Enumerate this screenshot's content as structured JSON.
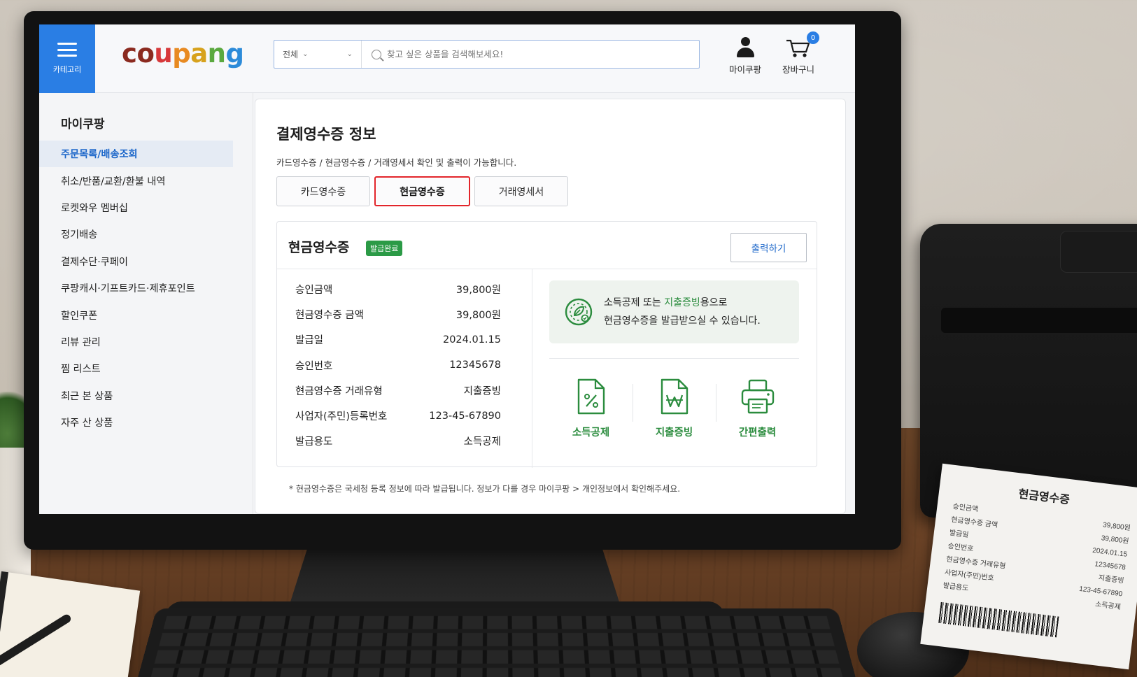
{
  "header": {
    "category_label": "카테고리",
    "logo_letters": [
      {
        "ch": "c",
        "color": "#8b2a1f"
      },
      {
        "ch": "o",
        "color": "#8b2a1f"
      },
      {
        "ch": "u",
        "color": "#d7383a"
      },
      {
        "ch": "p",
        "color": "#e88a21"
      },
      {
        "ch": "a",
        "color": "#d7a21d"
      },
      {
        "ch": "n",
        "color": "#5ba93f"
      },
      {
        "ch": "g",
        "color": "#2c8bd9"
      }
    ],
    "search_category": "전체",
    "search_placeholder": "찾고 싶은 상품을 검색해보세요!",
    "my_label": "마이쿠팡",
    "cart_label": "장바구니",
    "cart_count": "0",
    "accent": "#2a7ee4"
  },
  "sidebar": {
    "title": "마이쿠팡",
    "items": [
      {
        "label": "주문목록/배송조회",
        "active": true
      },
      {
        "label": "취소/반품/교환/환불 내역"
      },
      {
        "label": "로켓와우 멤버십"
      },
      {
        "label": "정기배송"
      },
      {
        "label": "결제수단·쿠페이"
      },
      {
        "label": "쿠팡캐시·기프트카드·제휴포인트"
      },
      {
        "label": "할인쿠폰"
      },
      {
        "label": "리뷰 관리"
      },
      {
        "label": "찜 리스트"
      },
      {
        "label": "최근 본 상품"
      },
      {
        "label": "자주 산 상품"
      }
    ]
  },
  "main": {
    "title": "결제영수증 정보",
    "subtitle": "카드영수증 / 현금영수증 / 거래영세서 확인 및 출력이 가능합니다.",
    "tabs": [
      {
        "label": "카드영수증"
      },
      {
        "label": "현금영수증",
        "active": true
      },
      {
        "label": "거래영세서"
      }
    ],
    "panel": {
      "title": "현금영수증",
      "status": "발급완료",
      "print_button": "출력하기",
      "rows": [
        {
          "label": "승인금액",
          "value": "39,800원"
        },
        {
          "label": "현금영수증 금액",
          "value": "39,800원"
        },
        {
          "label": "발급일",
          "value": "2024.01.15"
        },
        {
          "label": "승인번호",
          "value": "12345678"
        },
        {
          "label": "현금영수증 거래유형",
          "value": "지출증빙"
        },
        {
          "label": "사업자(주민)등록번호",
          "value": "123-45-67890"
        },
        {
          "label": "발급용도",
          "value": "소득공제"
        }
      ],
      "notice_line1_pre": "소득공제 또는 ",
      "notice_line1_hl": "지출증빙",
      "notice_line1_post": "용으로",
      "notice_line2": "현금영수증을 발급받으실 수 있습니다.",
      "features": [
        {
          "label": "소득공제",
          "icon": "percent-doc-icon"
        },
        {
          "label": "지출증빙",
          "icon": "won-doc-icon"
        },
        {
          "label": "간편출력",
          "icon": "printer-icon"
        }
      ],
      "green": "#2b8c3e"
    },
    "footnote_pre": "* 현금영수증은 국세청 등록 정보에 따라 발급됩니다. 정보가 다를 경우 ",
    "footnote_link": "마이쿠팡 > 개인정보",
    "footnote_post": "에서 확인해주세요."
  },
  "paper_receipt": {
    "title": "현금영수증",
    "rows": [
      {
        "label": "승인금액",
        "value": "39,800원"
      },
      {
        "label": "현금영수증 금액",
        "value": "39,800원"
      },
      {
        "label": "발급일",
        "value": "2024.01.15"
      },
      {
        "label": "승인번호",
        "value": "12345678"
      },
      {
        "label": "현금영수증 거래유형",
        "value": "지출증빙"
      },
      {
        "label": "사업자(주민)번호",
        "value": "123-45-67890"
      },
      {
        "label": "발급용도",
        "value": "소득공제"
      }
    ]
  }
}
